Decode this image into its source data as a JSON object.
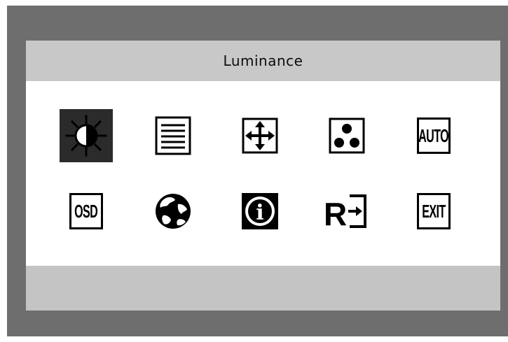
{
  "osd": {
    "title": "Luminance",
    "row1": [
      {
        "name": "luminance-icon",
        "label": ""
      },
      {
        "name": "image-setup-icon",
        "label": ""
      },
      {
        "name": "image-position-icon",
        "label": ""
      },
      {
        "name": "color-setup-icon",
        "label": ""
      },
      {
        "name": "auto-adjust-icon",
        "label": "AUTO"
      }
    ],
    "row2": [
      {
        "name": "osd-setup-icon",
        "label": "OSD"
      },
      {
        "name": "language-icon",
        "label": ""
      },
      {
        "name": "information-icon",
        "label": "i"
      },
      {
        "name": "reset-icon",
        "label": "R"
      },
      {
        "name": "exit-icon",
        "label": "EXIT"
      }
    ]
  },
  "colors": {
    "frame": "#6e6e6e",
    "panel": "#c8c8c8",
    "content": "#ffffff",
    "selected": "#2b2b2b"
  }
}
